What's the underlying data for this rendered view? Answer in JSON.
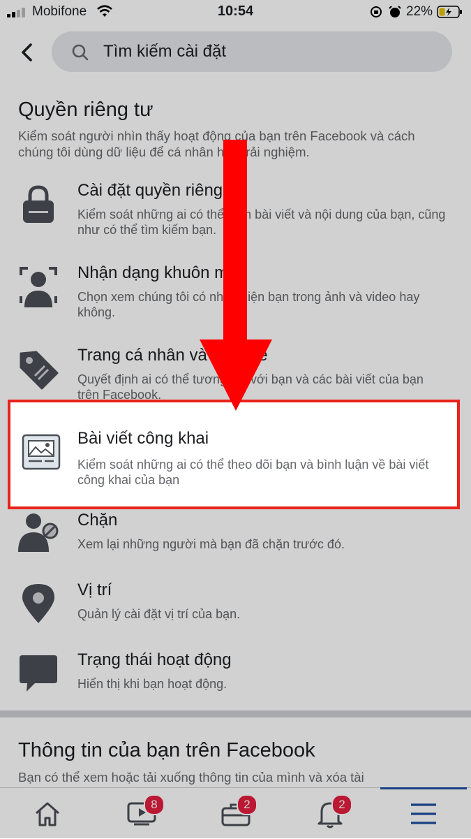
{
  "status_bar": {
    "carrier": "Mobifone",
    "time": "10:54",
    "battery": "22%"
  },
  "search": {
    "placeholder": "Tìm kiếm cài đặt"
  },
  "privacy": {
    "title": "Quyền riêng tư",
    "description": "Kiểm soát người nhìn thấy hoạt động của bạn trên Facebook và cách chúng tôi dùng dữ liệu để cá nhân hóa trải nghiệm.",
    "items": [
      {
        "title": "Cài đặt quyền riêng tư",
        "description": "Kiểm soát những ai có thể xem bài viết và nội dung của bạn, cũng như có thể tìm kiếm bạn.",
        "icon": "lock-icon"
      },
      {
        "title": "Nhận dạng khuôn mặt",
        "description": "Chọn xem chúng tôi có nhận diện bạn trong ảnh và video hay không.",
        "icon": "face-recognition-icon"
      },
      {
        "title": "Trang cá nhân và gắn thẻ",
        "description": "Quyết định ai có thể tương tác với bạn và các bài viết của bạn trên Facebook.",
        "icon": "tag-icon"
      },
      {
        "title": "Bài viết công khai",
        "description": "Kiểm soát những ai có thể theo dõi bạn và bình luận về bài viết công khai của bạn",
        "icon": "public-posts-icon"
      },
      {
        "title": "Chặn",
        "description": "Xem lại những người mà bạn đã chặn trước đó.",
        "icon": "block-user-icon"
      },
      {
        "title": "Vị trí",
        "description": "Quản lý cài đặt vị trí của bạn.",
        "icon": "location-pin-icon"
      },
      {
        "title": "Trạng thái hoạt động",
        "description": "Hiển thị khi bạn hoạt động.",
        "icon": "chat-bubble-icon"
      }
    ]
  },
  "your_info": {
    "title": "Thông tin của bạn trên Facebook",
    "description": "Bạn có thể xem hoặc tải xuống thông tin của mình và xóa tài"
  },
  "tab_bar": {
    "tabs": [
      {
        "name": "home",
        "badge": ""
      },
      {
        "name": "watch",
        "badge": "8"
      },
      {
        "name": "marketplace",
        "badge": "2"
      },
      {
        "name": "notifications",
        "badge": "2"
      },
      {
        "name": "menu",
        "badge": ""
      }
    ]
  },
  "colors": {
    "highlight": "#e8231b",
    "arrow": "#ff0000",
    "badge": "#e41e3f",
    "active_tab": "#1f4f9e"
  }
}
